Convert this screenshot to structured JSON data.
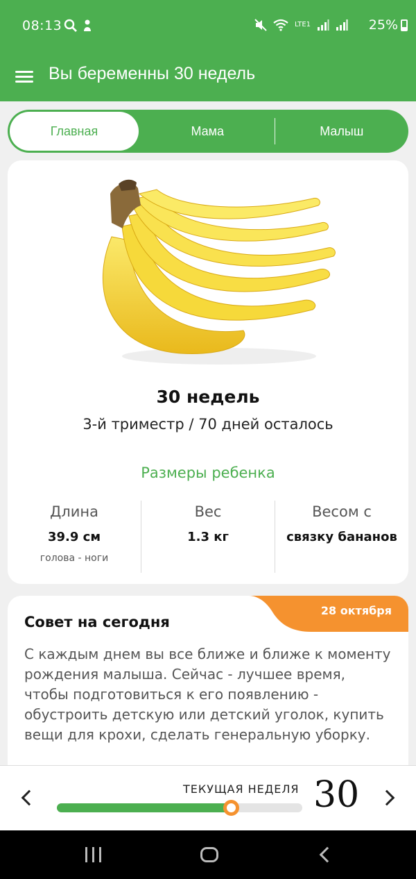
{
  "status_bar": {
    "time": "08:13",
    "network": "LTE1",
    "battery": "25%",
    "icons": [
      "search-icon",
      "notification-icon",
      "mute-icon",
      "wifi-icon",
      "volte-icon",
      "signal-icon",
      "battery-icon"
    ]
  },
  "app_bar": {
    "title": "Вы беременны 30 недель",
    "menu_icon": "menu-icon"
  },
  "tabs": [
    {
      "label": "Главная",
      "active": true
    },
    {
      "label": "Мама",
      "active": false
    },
    {
      "label": "Малыш",
      "active": false
    }
  ],
  "main_card": {
    "image": "banana-bunch",
    "weeks": "30 недель",
    "trimester": "3-й триместр / 70 дней осталось",
    "sizes_title": "Размеры ребенка",
    "stats": [
      {
        "label": "Длина",
        "value": "39.9 см",
        "sub": "голова - ноги"
      },
      {
        "label": "Вес",
        "value": "1.3 кг",
        "sub": ""
      },
      {
        "label": "Весом с",
        "value": "связку бананов",
        "sub": ""
      }
    ]
  },
  "tip_card": {
    "title": "Совет на сегодня",
    "date": "28 октября",
    "text": "С каждым днем вы все ближе и ближе к моменту рождения малыша. Сейчас - лучшее время, чтобы подготовиться к его появлению - обустроить детскую или детский уголок, купить вещи для крохи, сделать генеральную уборку."
  },
  "week_selector": {
    "label": "ТЕКУЩАЯ НЕДЕЛЯ",
    "week": "30",
    "progress": 0.71
  },
  "colors": {
    "primary": "#4caf50",
    "accent": "#f5922f",
    "banana": "#f4d63a"
  }
}
